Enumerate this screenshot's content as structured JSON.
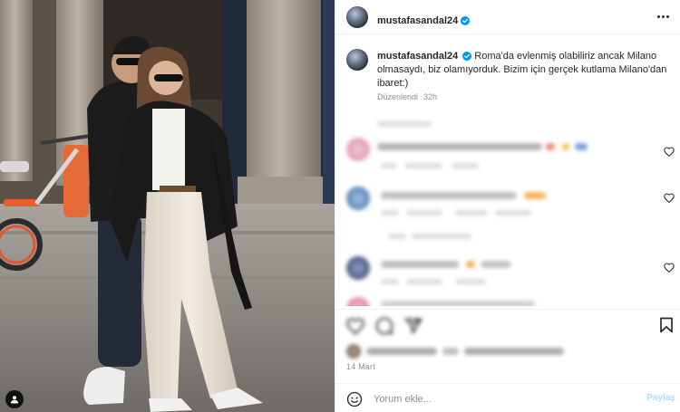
{
  "post": {
    "username": "mustafasandal24",
    "verified": true,
    "caption": "Roma'da evlenmiş olabiliriz ancak Milano olmasaydı, biz olamıyorduk. Bizim için gerçek kutlama Milano'dan ibaret:)",
    "edited_label": "Düzenlendi",
    "age": "32h",
    "date": "14 Mart"
  },
  "comment_box": {
    "placeholder": "Yorum ekle...",
    "post_label": "Paylaş"
  },
  "colors": {
    "verified_blue": "#0095f6",
    "post_button_disabled": "#b3dbff",
    "meta_gray": "#8e8e8e"
  },
  "icons": [
    "verified-badge-icon",
    "more-options-icon",
    "heart-icon",
    "comment-icon",
    "share-icon",
    "bookmark-icon",
    "emoji-icon",
    "user-tag-icon"
  ]
}
